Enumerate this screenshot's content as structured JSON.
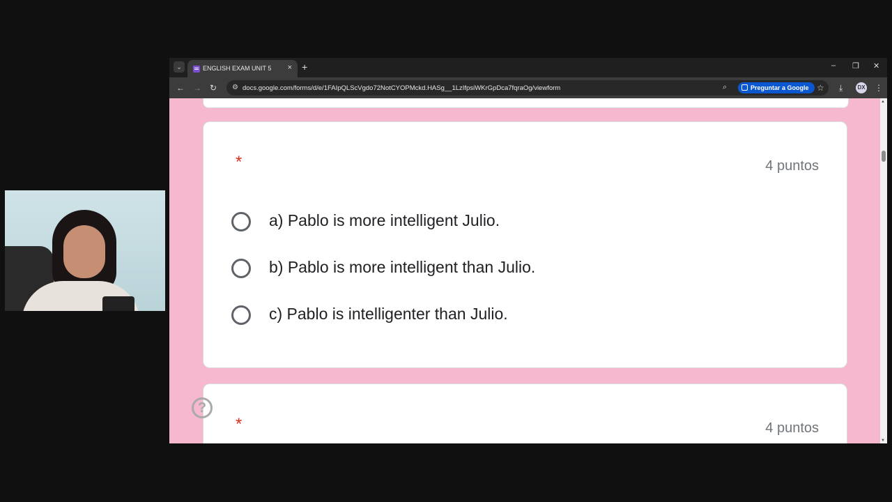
{
  "browser": {
    "tab_title": "ENGLISH EXAM UNIT 5",
    "tab_close": "×",
    "new_tab": "+",
    "tab_dropdown": "⌄",
    "url": "docs.google.com/forms/d/e/1FAIpQLScVgdo72NotCYOPMckd.HASg__1LzIfpsiWKrGpDca7fqraOg/viewform",
    "ask_google": "Preguntar a Google",
    "profile_initials": "DX",
    "window_controls": {
      "minimize": "–",
      "restore": "❐",
      "close": "✕"
    },
    "nav": {
      "back": "←",
      "forward": "→",
      "reload": "↻"
    },
    "icons": {
      "zoom": "⌕",
      "star": "☆",
      "download": "⤓",
      "menu": "⋮",
      "site_info": "⚙"
    }
  },
  "form": {
    "accent_color": "#f6b8cf",
    "questions": [
      {
        "required_marker": "*",
        "points": "4 puntos",
        "options": [
          "a) Pablo is more intelligent Julio.",
          "b) Pablo is more intelligent than Julio.",
          "c) Pablo is intelligenter than Julio."
        ]
      },
      {
        "required_marker": "*",
        "points": "4 puntos"
      }
    ],
    "help_icon": "?"
  }
}
